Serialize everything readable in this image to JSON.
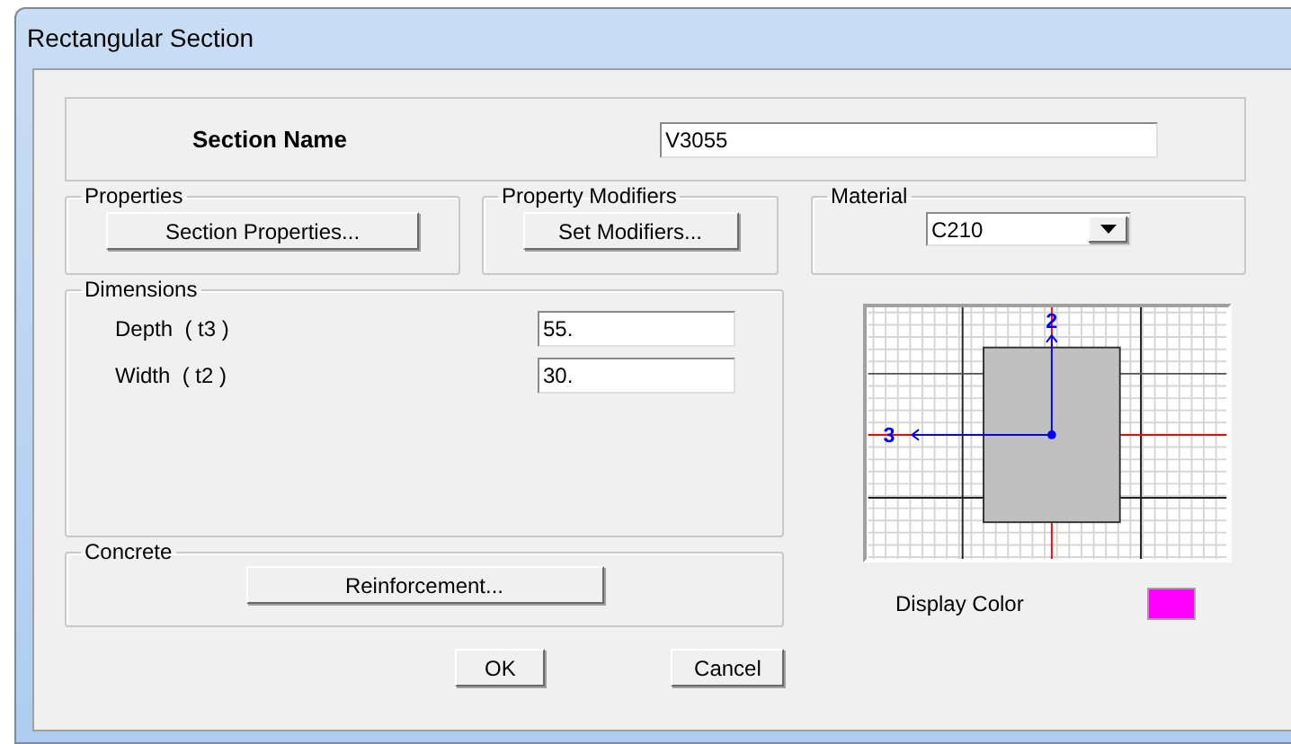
{
  "window": {
    "title": "Rectangular Section"
  },
  "section_name": {
    "label": "Section Name",
    "value": "V3055"
  },
  "properties": {
    "title": "Properties",
    "button": "Section Properties..."
  },
  "property_modifiers": {
    "title": "Property Modifiers",
    "button": "Set Modifiers..."
  },
  "material": {
    "title": "Material",
    "value": "C210"
  },
  "dimensions": {
    "title": "Dimensions",
    "fields": [
      {
        "label": "Depth  ( t3 )",
        "value": "55."
      },
      {
        "label": "Width  ( t2 )",
        "value": "30."
      }
    ]
  },
  "concrete": {
    "title": "Concrete",
    "button": "Reinforcement..."
  },
  "preview": {
    "axis_2": "2",
    "axis_3": "3"
  },
  "display_color": {
    "label": "Display Color",
    "color": "#ff00ff"
  },
  "buttons": [
    "OK",
    "Cancel"
  ]
}
